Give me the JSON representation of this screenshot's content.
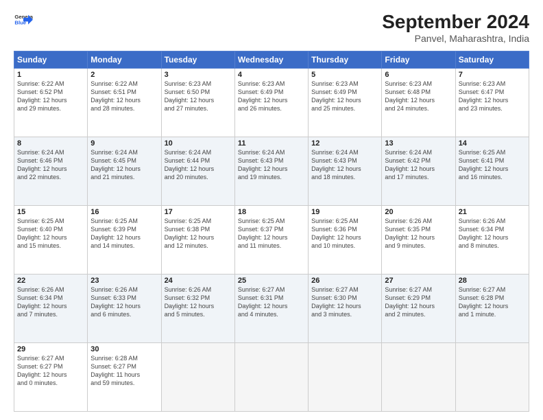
{
  "logo": {
    "line1": "General",
    "line2": "Blue"
  },
  "title": "September 2024",
  "subtitle": "Panvel, Maharashtra, India",
  "days_of_week": [
    "Sunday",
    "Monday",
    "Tuesday",
    "Wednesday",
    "Thursday",
    "Friday",
    "Saturday"
  ],
  "weeks": [
    [
      {
        "day": "1",
        "info": "Sunrise: 6:22 AM\nSunset: 6:52 PM\nDaylight: 12 hours\nand 29 minutes."
      },
      {
        "day": "2",
        "info": "Sunrise: 6:22 AM\nSunset: 6:51 PM\nDaylight: 12 hours\nand 28 minutes."
      },
      {
        "day": "3",
        "info": "Sunrise: 6:23 AM\nSunset: 6:50 PM\nDaylight: 12 hours\nand 27 minutes."
      },
      {
        "day": "4",
        "info": "Sunrise: 6:23 AM\nSunset: 6:49 PM\nDaylight: 12 hours\nand 26 minutes."
      },
      {
        "day": "5",
        "info": "Sunrise: 6:23 AM\nSunset: 6:49 PM\nDaylight: 12 hours\nand 25 minutes."
      },
      {
        "day": "6",
        "info": "Sunrise: 6:23 AM\nSunset: 6:48 PM\nDaylight: 12 hours\nand 24 minutes."
      },
      {
        "day": "7",
        "info": "Sunrise: 6:23 AM\nSunset: 6:47 PM\nDaylight: 12 hours\nand 23 minutes."
      }
    ],
    [
      {
        "day": "8",
        "info": "Sunrise: 6:24 AM\nSunset: 6:46 PM\nDaylight: 12 hours\nand 22 minutes."
      },
      {
        "day": "9",
        "info": "Sunrise: 6:24 AM\nSunset: 6:45 PM\nDaylight: 12 hours\nand 21 minutes."
      },
      {
        "day": "10",
        "info": "Sunrise: 6:24 AM\nSunset: 6:44 PM\nDaylight: 12 hours\nand 20 minutes."
      },
      {
        "day": "11",
        "info": "Sunrise: 6:24 AM\nSunset: 6:43 PM\nDaylight: 12 hours\nand 19 minutes."
      },
      {
        "day": "12",
        "info": "Sunrise: 6:24 AM\nSunset: 6:43 PM\nDaylight: 12 hours\nand 18 minutes."
      },
      {
        "day": "13",
        "info": "Sunrise: 6:24 AM\nSunset: 6:42 PM\nDaylight: 12 hours\nand 17 minutes."
      },
      {
        "day": "14",
        "info": "Sunrise: 6:25 AM\nSunset: 6:41 PM\nDaylight: 12 hours\nand 16 minutes."
      }
    ],
    [
      {
        "day": "15",
        "info": "Sunrise: 6:25 AM\nSunset: 6:40 PM\nDaylight: 12 hours\nand 15 minutes."
      },
      {
        "day": "16",
        "info": "Sunrise: 6:25 AM\nSunset: 6:39 PM\nDaylight: 12 hours\nand 14 minutes."
      },
      {
        "day": "17",
        "info": "Sunrise: 6:25 AM\nSunset: 6:38 PM\nDaylight: 12 hours\nand 12 minutes."
      },
      {
        "day": "18",
        "info": "Sunrise: 6:25 AM\nSunset: 6:37 PM\nDaylight: 12 hours\nand 11 minutes."
      },
      {
        "day": "19",
        "info": "Sunrise: 6:25 AM\nSunset: 6:36 PM\nDaylight: 12 hours\nand 10 minutes."
      },
      {
        "day": "20",
        "info": "Sunrise: 6:26 AM\nSunset: 6:35 PM\nDaylight: 12 hours\nand 9 minutes."
      },
      {
        "day": "21",
        "info": "Sunrise: 6:26 AM\nSunset: 6:34 PM\nDaylight: 12 hours\nand 8 minutes."
      }
    ],
    [
      {
        "day": "22",
        "info": "Sunrise: 6:26 AM\nSunset: 6:34 PM\nDaylight: 12 hours\nand 7 minutes."
      },
      {
        "day": "23",
        "info": "Sunrise: 6:26 AM\nSunset: 6:33 PM\nDaylight: 12 hours\nand 6 minutes."
      },
      {
        "day": "24",
        "info": "Sunrise: 6:26 AM\nSunset: 6:32 PM\nDaylight: 12 hours\nand 5 minutes."
      },
      {
        "day": "25",
        "info": "Sunrise: 6:27 AM\nSunset: 6:31 PM\nDaylight: 12 hours\nand 4 minutes."
      },
      {
        "day": "26",
        "info": "Sunrise: 6:27 AM\nSunset: 6:30 PM\nDaylight: 12 hours\nand 3 minutes."
      },
      {
        "day": "27",
        "info": "Sunrise: 6:27 AM\nSunset: 6:29 PM\nDaylight: 12 hours\nand 2 minutes."
      },
      {
        "day": "28",
        "info": "Sunrise: 6:27 AM\nSunset: 6:28 PM\nDaylight: 12 hours\nand 1 minute."
      }
    ],
    [
      {
        "day": "29",
        "info": "Sunrise: 6:27 AM\nSunset: 6:27 PM\nDaylight: 12 hours\nand 0 minutes."
      },
      {
        "day": "30",
        "info": "Sunrise: 6:28 AM\nSunset: 6:27 PM\nDaylight: 11 hours\nand 59 minutes."
      },
      {
        "day": "",
        "info": ""
      },
      {
        "day": "",
        "info": ""
      },
      {
        "day": "",
        "info": ""
      },
      {
        "day": "",
        "info": ""
      },
      {
        "day": "",
        "info": ""
      }
    ]
  ]
}
